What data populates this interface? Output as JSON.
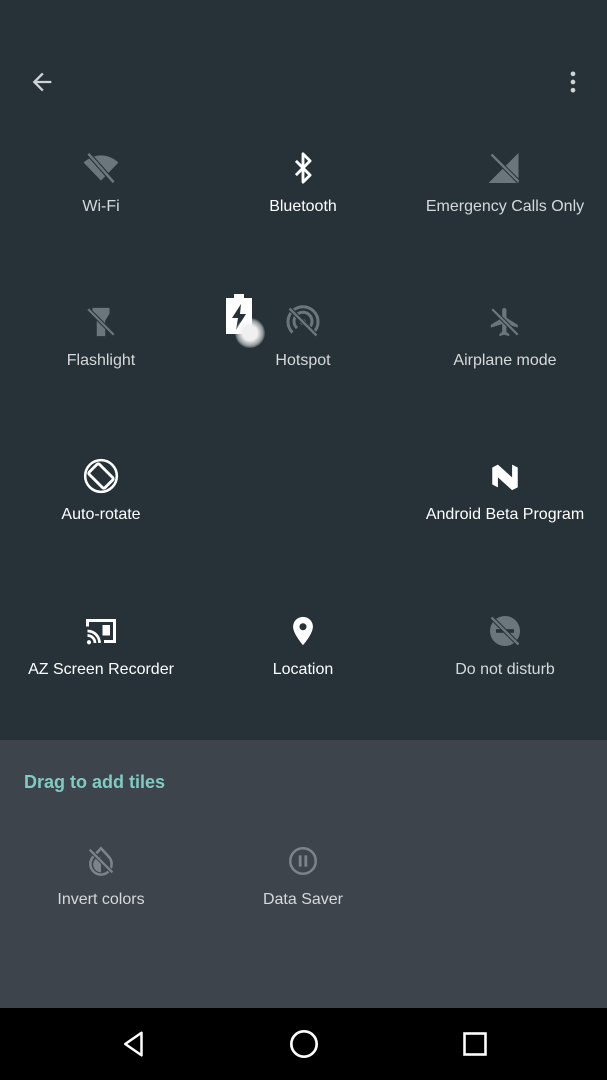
{
  "app_bar": {
    "back_icon": "arrow-back-icon",
    "more_icon": "more-vert-icon"
  },
  "tiles": [
    {
      "label": "Wi-Fi",
      "icon": "wifi-off-icon"
    },
    {
      "label": "Bluetooth",
      "icon": "bluetooth-icon"
    },
    {
      "label": "Emergency Calls Only",
      "icon": "signal-off-icon"
    },
    {
      "label": "Flashlight",
      "icon": "flashlight-off-icon"
    },
    {
      "label": "Hotspot",
      "icon": "hotspot-off-icon"
    },
    {
      "label": "Airplane mode",
      "icon": "airplane-off-icon"
    },
    {
      "label": "Auto-rotate",
      "icon": "auto-rotate-icon"
    },
    {
      "label": "Android Beta Program",
      "icon": "android-beta-icon"
    },
    {
      "label": "AZ Screen Recorder",
      "icon": "cast-icon"
    },
    {
      "label": "Location",
      "icon": "location-pin-icon"
    },
    {
      "label": "Do not disturb",
      "icon": "do-not-disturb-icon"
    }
  ],
  "drag_section": {
    "title": "Drag to add tiles",
    "tiles": [
      {
        "label": "Invert colors",
        "icon": "invert-colors-icon"
      },
      {
        "label": "Data Saver",
        "icon": "data-saver-icon"
      }
    ]
  },
  "nav": {
    "back_icon": "nav-back-icon",
    "home_icon": "nav-home-icon",
    "recents_icon": "nav-recents-icon"
  },
  "colors": {
    "background": "#263238",
    "drag_background": "#3d444b",
    "accent": "#80cbc4"
  }
}
